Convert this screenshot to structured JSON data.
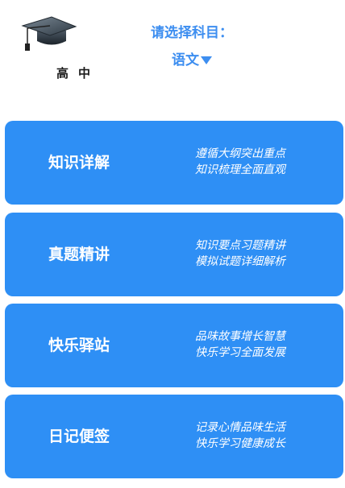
{
  "header": {
    "logo_text": "高中",
    "logo_icon": "graduation-cap-icon",
    "prompt": "请选择科目：",
    "selected_subject": "语文"
  },
  "colors": {
    "accent": "#3d8ef0",
    "card": "#2e8ff5",
    "card_text": "#ffffff"
  },
  "cards": [
    {
      "title": "知识详解",
      "line1": "遵循大纲突出重点",
      "line2": "知识梳理全面直观"
    },
    {
      "title": "真题精讲",
      "line1": "知识要点习题精讲",
      "line2": "模拟试题详细解析"
    },
    {
      "title": "快乐驿站",
      "line1": "品味故事增长智慧",
      "line2": "快乐学习全面发展"
    },
    {
      "title": "日记便签",
      "line1": "记录心情品味生活",
      "line2": "快乐学习健康成长"
    }
  ]
}
